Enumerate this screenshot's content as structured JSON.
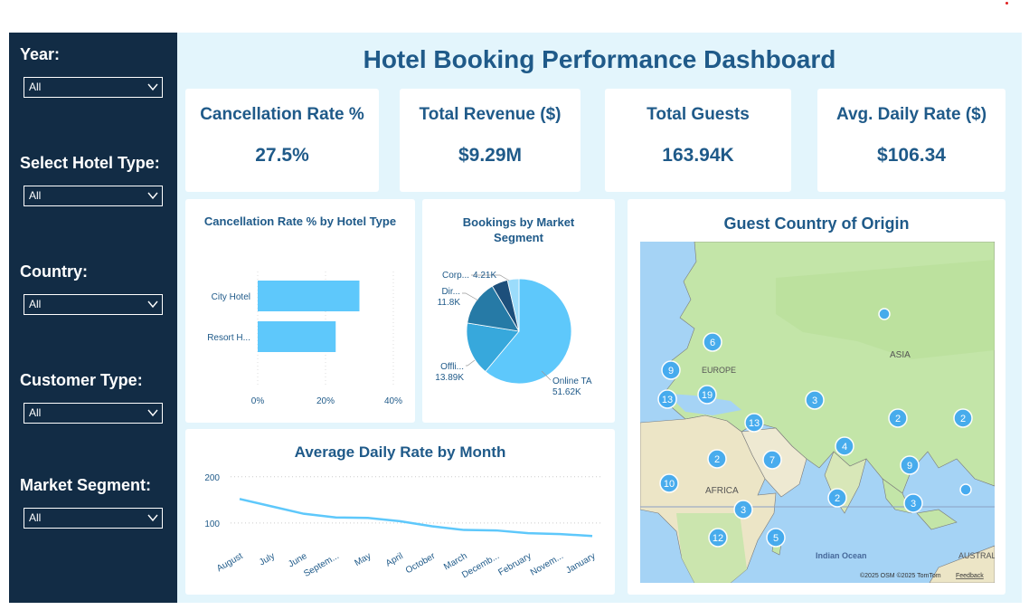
{
  "sidebar": {
    "slicers": [
      {
        "title": "Year:",
        "value": "All"
      },
      {
        "title": "Select Hotel Type:",
        "value": "All"
      },
      {
        "title": "Country:",
        "value": "All"
      },
      {
        "title": "Customer Type:",
        "value": "All"
      },
      {
        "title": "Market Segment:",
        "value": "All"
      }
    ]
  },
  "dashboard": {
    "title": "Hotel Booking Performance Dashboard"
  },
  "kpis": [
    {
      "label": "Cancellation Rate %",
      "value": "27.5%"
    },
    {
      "label": "Total Revenue ($)",
      "value": "$9.29M"
    },
    {
      "label": "Total Guests",
      "value": "163.94K"
    },
    {
      "label": "Avg. Daily Rate ($)",
      "value": "$106.34"
    }
  ],
  "map": {
    "title": "Guest Country of Origin",
    "labels": {
      "europe": "EUROPE",
      "asia": "ASIA",
      "africa": "AFRICA",
      "indian_ocean": "Indian Ocean",
      "australia": "AUSTRAL"
    },
    "attribution": "©2025 OSM ©2025 TomTom",
    "feedback": "Feedback",
    "bubbles": [
      "6",
      "9",
      "13",
      "19",
      "3",
      "13",
      "2",
      "2",
      "2",
      "7",
      "4",
      "9",
      "10",
      "2",
      "3",
      "3",
      "12",
      "5",
      "",
      ""
    ]
  },
  "colors": {
    "sidebar": "#122c45",
    "accent": "#1f5a89",
    "bar": "#5ec8fb",
    "pie": [
      "#5ec8fb",
      "#37a8dc",
      "#267aa6",
      "#1d4f7b",
      "#9bdcfb"
    ]
  },
  "chart_data": [
    {
      "type": "bar",
      "title": "Cancellation Rate % by Hotel Type",
      "categories": [
        "City Hotel",
        "Resort H..."
      ],
      "values": [
        30,
        23
      ],
      "xticks": [
        "0%",
        "20%",
        "40%"
      ],
      "xlim": [
        0,
        40
      ]
    },
    {
      "type": "pie",
      "title": "Bookings by Market Segment",
      "labels": [
        "Online TA",
        "Offli...",
        "Dir...",
        "Corp..."
      ],
      "value_labels": [
        "51.62K",
        "13.89K",
        "11.8K",
        "4.21K"
      ],
      "values": [
        51.62,
        13.89,
        11.8,
        4.21,
        3.0
      ]
    },
    {
      "type": "line",
      "title": "Average Daily Rate by Month",
      "x": [
        "August",
        "July",
        "June",
        "Septem...",
        "May",
        "April",
        "October",
        "March",
        "Decemb...",
        "February",
        "Novem...",
        "January"
      ],
      "y": [
        152,
        136,
        120,
        112,
        111,
        104,
        93,
        85,
        84,
        78,
        76,
        72
      ],
      "yticks": [
        "200",
        "100"
      ],
      "ylim": [
        0,
        225
      ]
    }
  ]
}
